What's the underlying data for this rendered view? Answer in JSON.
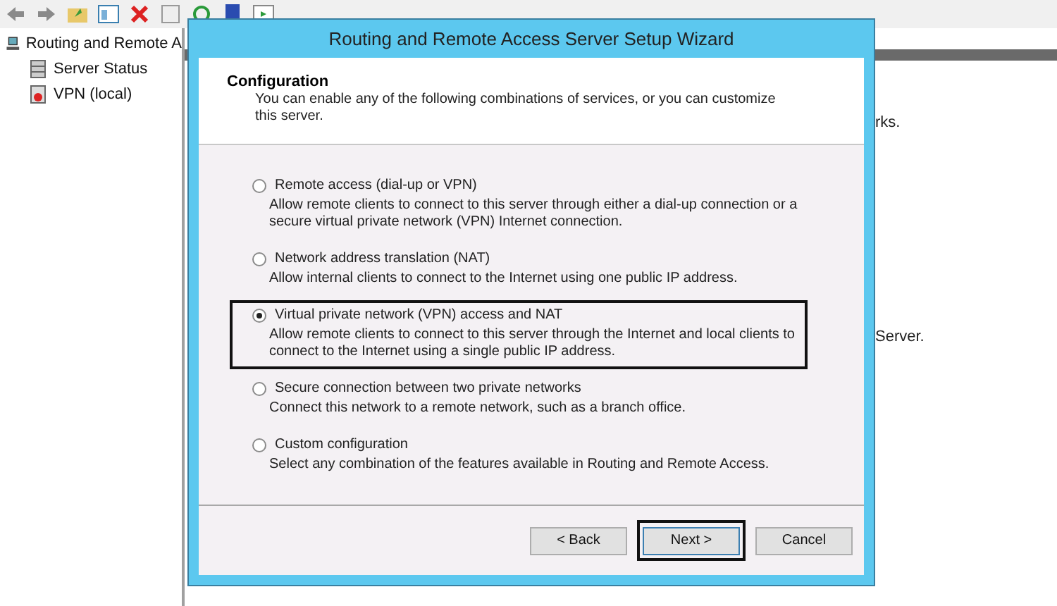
{
  "tree": {
    "label": "Routing and Remote A",
    "children": [
      {
        "label": "Server Status"
      },
      {
        "label": "VPN (local)"
      }
    ]
  },
  "right_pane": {
    "texts": [
      "rks.",
      "Server."
    ]
  },
  "wizard": {
    "title": "Routing and Remote Access Server Setup Wizard",
    "heading": "Configuration",
    "subheading": "You can enable any of the following combinations of services, or you can customize this server.",
    "options": [
      {
        "label": "Remote access (dial-up or VPN)",
        "description": "Allow remote clients to connect to this server through either a dial-up connection or a secure virtual private network (VPN) Internet connection.",
        "selected": false,
        "highlighted": false
      },
      {
        "label": "Network address translation (NAT)",
        "description": "Allow internal clients to connect to the Internet using one public IP address.",
        "selected": false,
        "highlighted": false
      },
      {
        "label": "Virtual private network (VPN) access and NAT",
        "description": "Allow remote clients to connect to this server through the Internet and local clients to connect to the Internet using a single public IP address.",
        "selected": true,
        "highlighted": true
      },
      {
        "label": "Secure connection between two private networks",
        "description": "Connect this network to a remote network, such as a branch office.",
        "selected": false,
        "highlighted": false
      },
      {
        "label": "Custom configuration",
        "description": "Select any combination of the features available in Routing and Remote Access.",
        "selected": false,
        "highlighted": false
      }
    ],
    "buttons": [
      {
        "label": "< Back",
        "highlighted": false
      },
      {
        "label": "Next >",
        "highlighted": true
      },
      {
        "label": "Cancel",
        "highlighted": false
      }
    ]
  }
}
